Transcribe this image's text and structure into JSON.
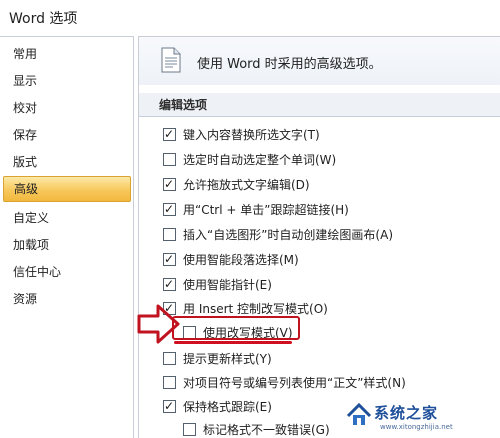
{
  "window": {
    "title": "Word 选项"
  },
  "sidebar": {
    "items": [
      {
        "label": "常用"
      },
      {
        "label": "显示"
      },
      {
        "label": "校对"
      },
      {
        "label": "保存"
      },
      {
        "label": "版式"
      },
      {
        "label": "高级",
        "active": true
      },
      {
        "label": "自定义"
      },
      {
        "label": "加载项"
      },
      {
        "label": "信任中心"
      },
      {
        "label": "资源"
      }
    ]
  },
  "header": {
    "text": "使用 Word 时采用的高级选项。"
  },
  "section": {
    "title": "编辑选项"
  },
  "options": [
    {
      "label": "键入内容替换所选文字(T)",
      "checked": true
    },
    {
      "label": "选定时自动选定整个单词(W)",
      "checked": false
    },
    {
      "label": "允许拖放式文字编辑(D)",
      "checked": true
    },
    {
      "label": "用“Ctrl + 单击”跟踪超链接(H)",
      "checked": true
    },
    {
      "label": "插入“自选图形”时自动创建绘图画布(A)",
      "checked": false
    },
    {
      "label": "使用智能段落选择(M)",
      "checked": true
    },
    {
      "label": "使用智能指针(E)",
      "checked": true
    },
    {
      "label": "用 Insert 控制改写模式(O)",
      "checked": true
    },
    {
      "label": "使用改写模式(V)",
      "checked": false
    },
    {
      "label": "提示更新样式(Y)",
      "checked": false
    },
    {
      "label": "对项目符号或编号列表使用“正文”样式(N)",
      "checked": false
    },
    {
      "label": "保持格式跟踪(E)",
      "checked": true
    },
    {
      "label": "标记格式不一致错误(G)",
      "checked": false
    }
  ],
  "watermark": {
    "text": "系统之家",
    "url": "www.xitongzhijia.net"
  },
  "colors": {
    "active_nav": "#f7c85c",
    "annotation_red": "#c1121f",
    "watermark_blue": "#1d4f9a"
  },
  "icons": {
    "header": "document-options-icon",
    "annotation": "arrow-right-icon",
    "checkbox_mark": "check-icon"
  }
}
